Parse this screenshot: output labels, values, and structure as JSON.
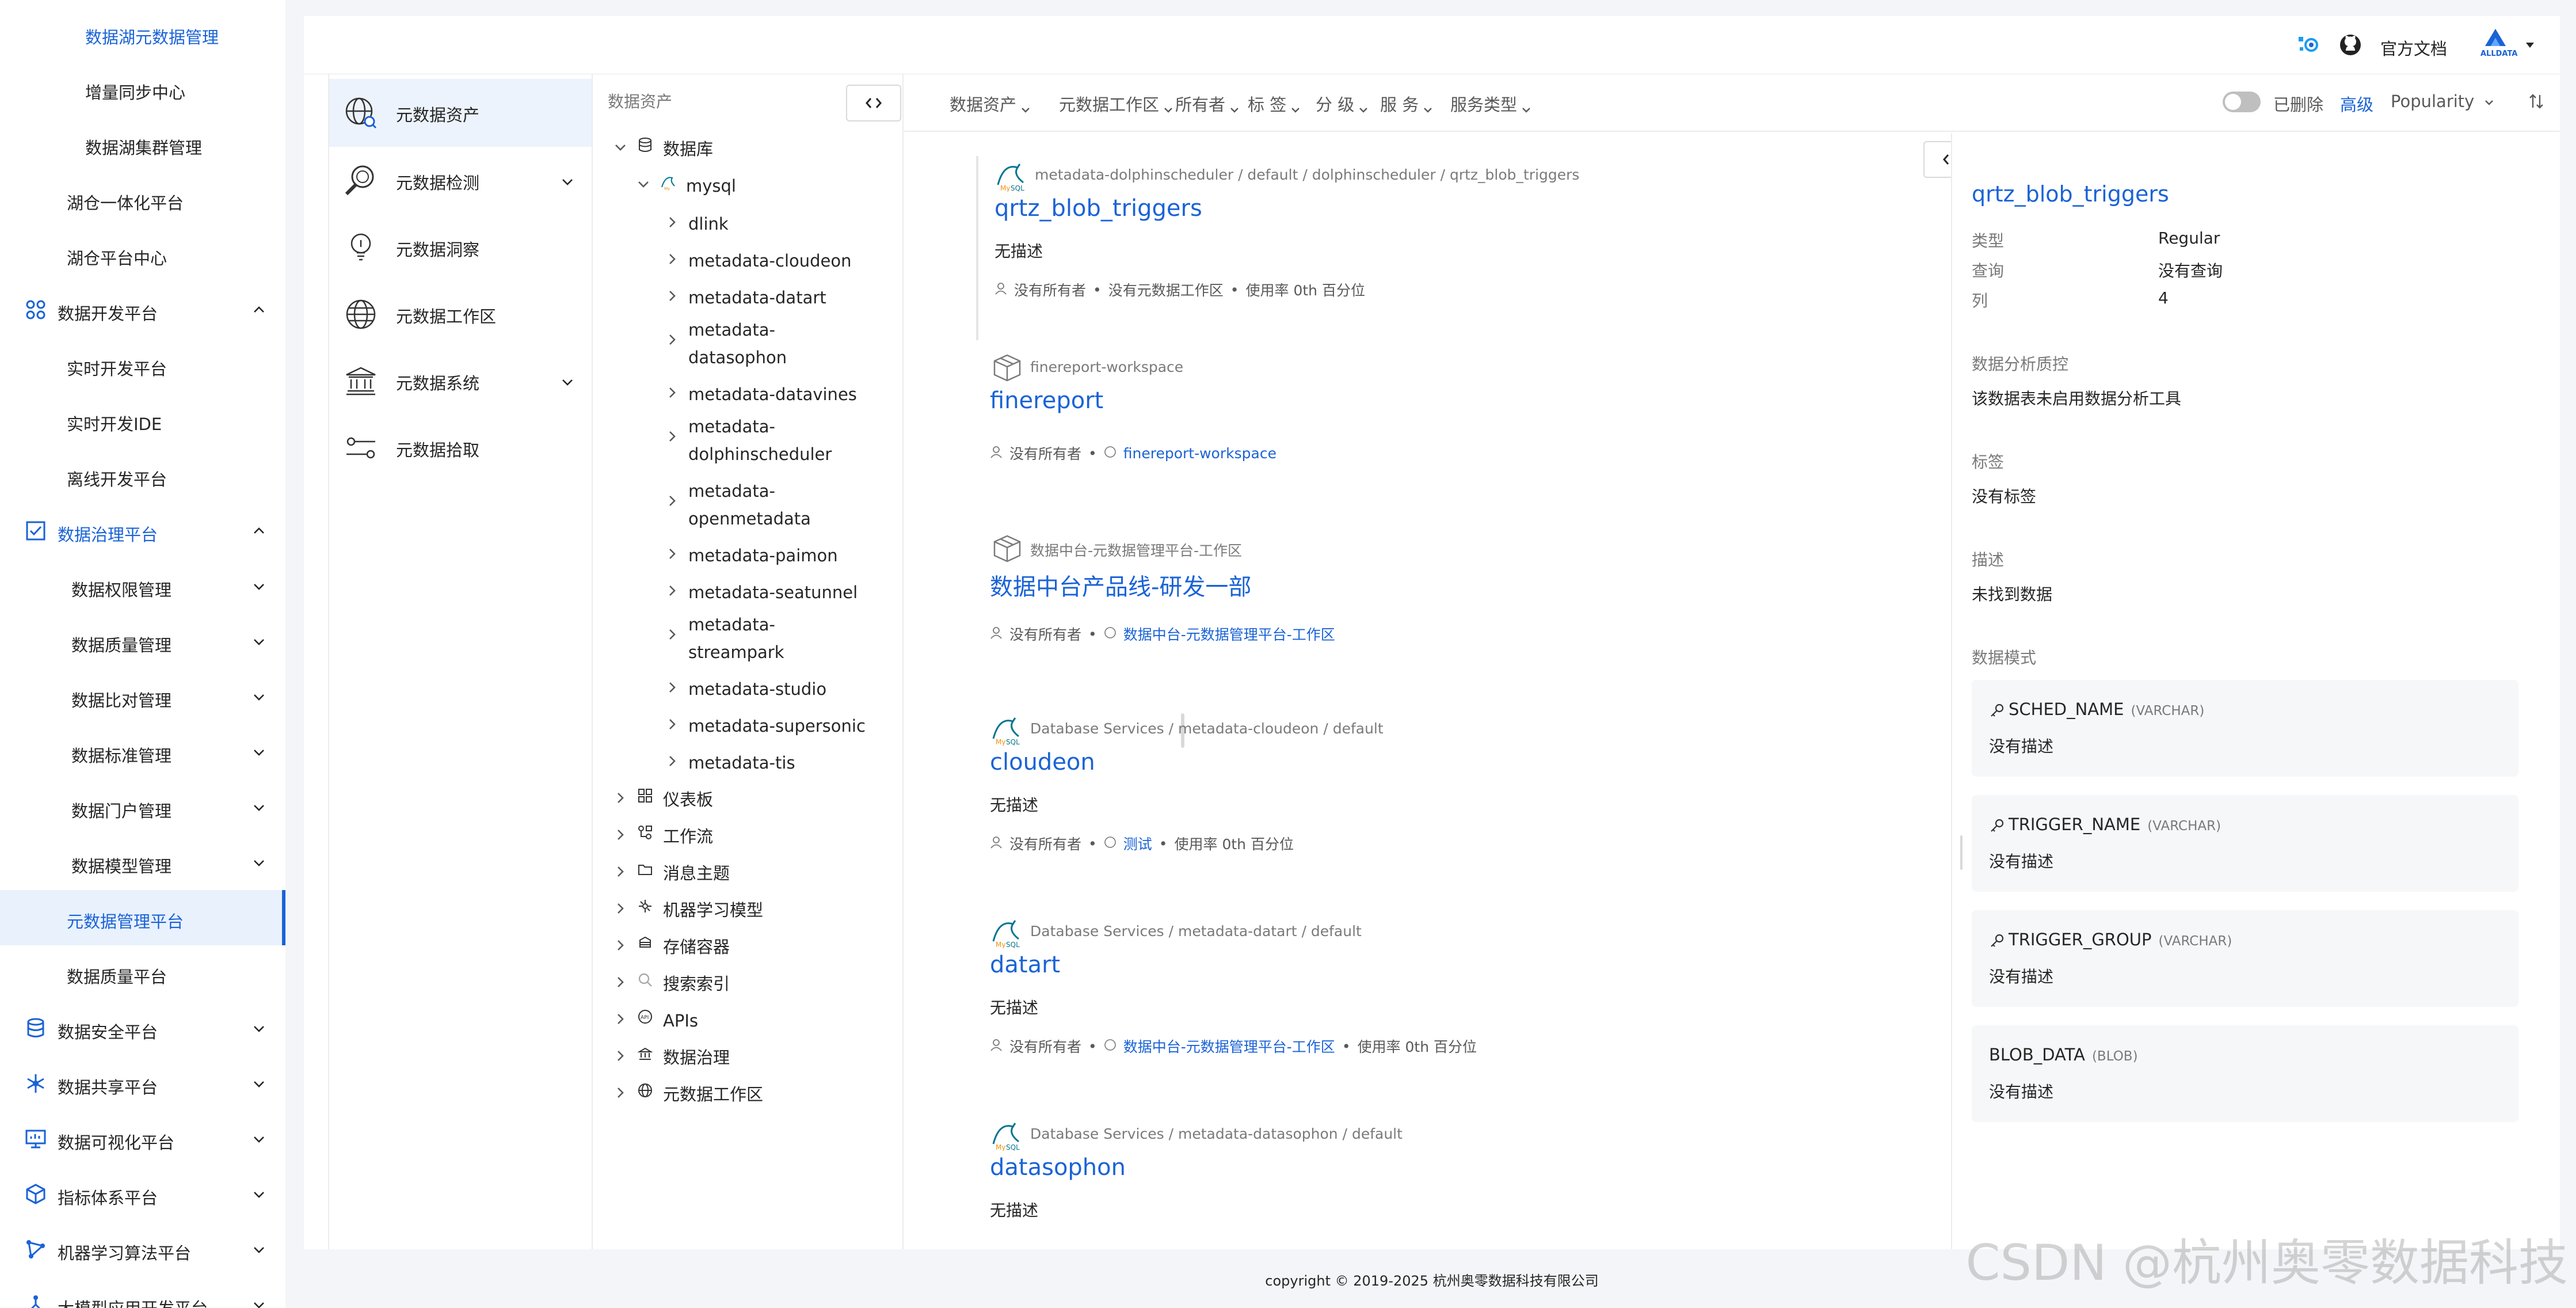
{
  "sidebar": {
    "items": [
      {
        "label": "数据湖元数据管理",
        "level": "sub",
        "state": "blue"
      },
      {
        "label": "增量同步中心",
        "level": "sub"
      },
      {
        "label": "数据湖集群管理",
        "level": "sub"
      },
      {
        "label": "湖仓一体化平台",
        "level": "sub2"
      },
      {
        "label": "湖仓平台中心",
        "level": "sub2"
      },
      {
        "label": "数据开发平台",
        "level": "top",
        "icon": "grid-icon",
        "expanded": true
      },
      {
        "label": "实时开发平台",
        "level": "sub2"
      },
      {
        "label": "实时开发IDE",
        "level": "sub2"
      },
      {
        "label": "离线开发平台",
        "level": "sub2"
      },
      {
        "label": "数据治理平台",
        "level": "top",
        "icon": "checklist-icon",
        "expanded": true,
        "state": "blue"
      },
      {
        "label": "数据权限管理",
        "level": "sub3",
        "has_children": true
      },
      {
        "label": "数据质量管理",
        "level": "sub3",
        "has_children": true
      },
      {
        "label": "数据比对管理",
        "level": "sub3",
        "has_children": true
      },
      {
        "label": "数据标准管理",
        "level": "sub3",
        "has_children": true
      },
      {
        "label": "数据门户管理",
        "level": "sub3",
        "has_children": true
      },
      {
        "label": "数据模型管理",
        "level": "sub3",
        "has_children": true
      },
      {
        "label": "元数据管理平台",
        "level": "sub2",
        "state": "active"
      },
      {
        "label": "数据质量平台",
        "level": "sub2"
      },
      {
        "label": "数据安全平台",
        "level": "top",
        "icon": "database-icon",
        "has_children": true
      },
      {
        "label": "数据共享平台",
        "level": "top",
        "icon": "snowflake-icon",
        "has_children": true
      },
      {
        "label": "数据可视化平台",
        "level": "top",
        "icon": "monitor-icon",
        "has_children": true
      },
      {
        "label": "指标体系平台",
        "level": "top",
        "icon": "cube-icon",
        "has_children": true
      },
      {
        "label": "机器学习算法平台",
        "level": "top",
        "icon": "network-icon",
        "has_children": true
      },
      {
        "label": "大模型应用开发平台",
        "level": "top",
        "icon": "tree-icon",
        "has_children": true
      }
    ]
  },
  "header": {
    "docs_label": "官方文档",
    "logo_text": "ALLDATA",
    "icons": [
      "integration-icon",
      "github-icon"
    ]
  },
  "menu": {
    "items": [
      {
        "label": "元数据资产",
        "icon": "asset-globe-icon",
        "active": true
      },
      {
        "label": "元数据检测",
        "icon": "magnifier-icon",
        "has_children": true
      },
      {
        "label": "元数据洞察",
        "icon": "bulb-icon"
      },
      {
        "label": "元数据工作区",
        "icon": "globe-icon"
      },
      {
        "label": "元数据系统",
        "icon": "bank-icon",
        "has_children": true
      },
      {
        "label": "元数据拾取",
        "icon": "pipeline-icon"
      }
    ]
  },
  "tree": {
    "title": "数据资产",
    "root": {
      "label": "数据库",
      "icon": "database-icon"
    },
    "service": {
      "label": "mysql",
      "icon": "mysql-icon"
    },
    "databases": [
      "dlink",
      "metadata-cloudeon",
      "metadata-datart",
      "metadata-\ndatasophon",
      "metadata-datavines",
      "metadata-\ndolphinscheduler",
      "metadata-\nopenmetadata",
      "metadata-paimon",
      "metadata-seatunnel",
      "metadata-\nstreampark",
      "metadata-studio",
      "metadata-supersonic",
      "metadata-tis"
    ],
    "categories": [
      {
        "label": "仪表板",
        "icon": "dashboard-icon"
      },
      {
        "label": "工作流",
        "icon": "workflow-icon"
      },
      {
        "label": "消息主题",
        "icon": "folder-icon"
      },
      {
        "label": "机器学习模型",
        "icon": "ml-icon"
      },
      {
        "label": "存储容器",
        "icon": "container-icon"
      },
      {
        "label": "搜索索引",
        "icon": "search-icon"
      },
      {
        "label": "APIs",
        "icon": "api-icon"
      },
      {
        "label": "数据治理",
        "icon": "governance-icon"
      },
      {
        "label": "元数据工作区",
        "icon": "globe-icon"
      }
    ]
  },
  "filters": {
    "items": [
      "数据资产",
      "元数据工作区",
      "所有者",
      "标 签",
      "分 级",
      "服 务",
      "服务类型"
    ],
    "deleted_label": "已删除",
    "advanced_label": "高级",
    "sort_label": "Popularity"
  },
  "results": [
    {
      "icon": "mysql-icon",
      "crumb": "metadata-dolphinscheduler  /  default  /  dolphinscheduler  /  qrtz_blob_triggers",
      "title": "qrtz_blob_triggers",
      "desc": "无描述",
      "meta": [
        "没有所有者",
        "没有元数据工作区",
        "使用率 0th 百分位"
      ]
    },
    {
      "icon": "box-icon",
      "crumb": "finereport-workspace",
      "title": "finereport",
      "desc": "",
      "meta": [
        "没有所有者"
      ],
      "link": "finereport-workspace"
    },
    {
      "icon": "box-icon",
      "crumb": "数据中台-元数据管理平台-工作区",
      "title": "数据中台产品线-研发一部",
      "desc": "",
      "meta": [
        "没有所有者"
      ],
      "link": "数据中台-元数据管理平台-工作区"
    },
    {
      "icon": "mysql-icon",
      "crumb": "Database Services  /  metadata-cloudeon  /  default",
      "title": "cloudeon",
      "desc": "无描述",
      "meta": [
        "没有所有者"
      ],
      "link": "测试",
      "tail": "使用率 0th 百分位"
    },
    {
      "icon": "mysql-icon",
      "crumb": "Database Services  /  metadata-datart  /  default",
      "title": "datart",
      "desc": "无描述",
      "meta": [
        "没有所有者"
      ],
      "link": "数据中台-元数据管理平台-工作区",
      "tail": "使用率 0th 百分位"
    },
    {
      "icon": "mysql-icon",
      "crumb": "Database Services  /  metadata-datasophon  /  default",
      "title": "datasophon",
      "desc": "无描述",
      "meta": []
    }
  ],
  "detail": {
    "title": "qrtz_blob_triggers",
    "props": [
      {
        "label": "类型",
        "value": "Regular"
      },
      {
        "label": "查询",
        "value": "没有查询"
      },
      {
        "label": "列",
        "value": "4"
      }
    ],
    "profiler_label": "数据分析质控",
    "profiler_value": "该数据表未启用数据分析工具",
    "tags_label": "标签",
    "tags_value": "没有标签",
    "desc_label": "描述",
    "desc_value": "未找到数据",
    "schema_label": "数据模式",
    "columns": [
      {
        "name": "SCHED_NAME",
        "type": "(VARCHAR)",
        "desc": "没有描述",
        "key": true
      },
      {
        "name": "TRIGGER_NAME",
        "type": "(VARCHAR)",
        "desc": "没有描述",
        "key": true
      },
      {
        "name": "TRIGGER_GROUP",
        "type": "(VARCHAR)",
        "desc": "没有描述",
        "key": true
      },
      {
        "name": "BLOB_DATA",
        "type": "(BLOB)",
        "desc": "没有描述",
        "key": false
      }
    ]
  },
  "footer": {
    "copyright": "copyright © 2019-2025 杭州奥零数据科技有限公司"
  },
  "watermark": "CSDN @杭州奥零数据科技",
  "colors": {
    "accent": "#1a63d6",
    "active_bg": "#e9f1fc",
    "page_bg": "#f4f5f8"
  }
}
